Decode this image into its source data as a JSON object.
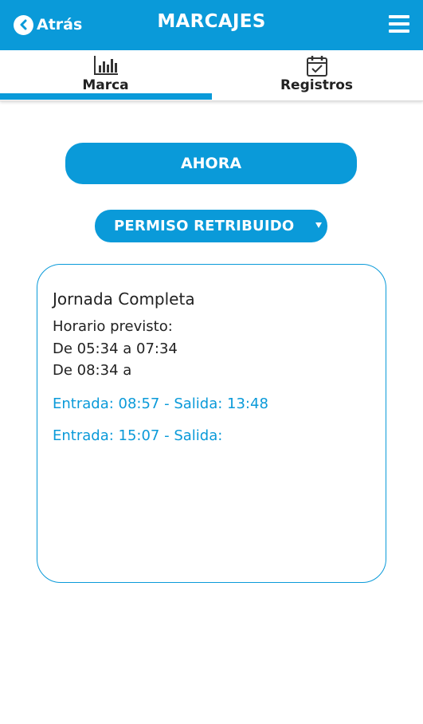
{
  "header": {
    "back_label": "Atrás",
    "title": "MARCAJES",
    "back_icon": "chevron-left-circle-icon",
    "menu_icon": "hamburger-menu-icon"
  },
  "tabs": [
    {
      "label": "Marca",
      "icon": "bar-chart-icon",
      "active": true
    },
    {
      "label": "Registros",
      "icon": "calendar-check-icon",
      "active": false
    }
  ],
  "actions": {
    "now_label": "AHORA"
  },
  "absence_select": {
    "value": "PERMISO RETRIBUIDO"
  },
  "schedule": {
    "title": "Jornada Completa",
    "expected_label": "Horario previsto:",
    "expected": [
      "De 05:34 a 07:34",
      "De 08:34 a"
    ],
    "records": [
      "Entrada: 08:57 - Salida: 13:48",
      "Entrada: 15:07 - Salida:"
    ]
  },
  "colors": {
    "accent": "#0a9ad9",
    "text": "#222222",
    "background": "#ffffff"
  }
}
